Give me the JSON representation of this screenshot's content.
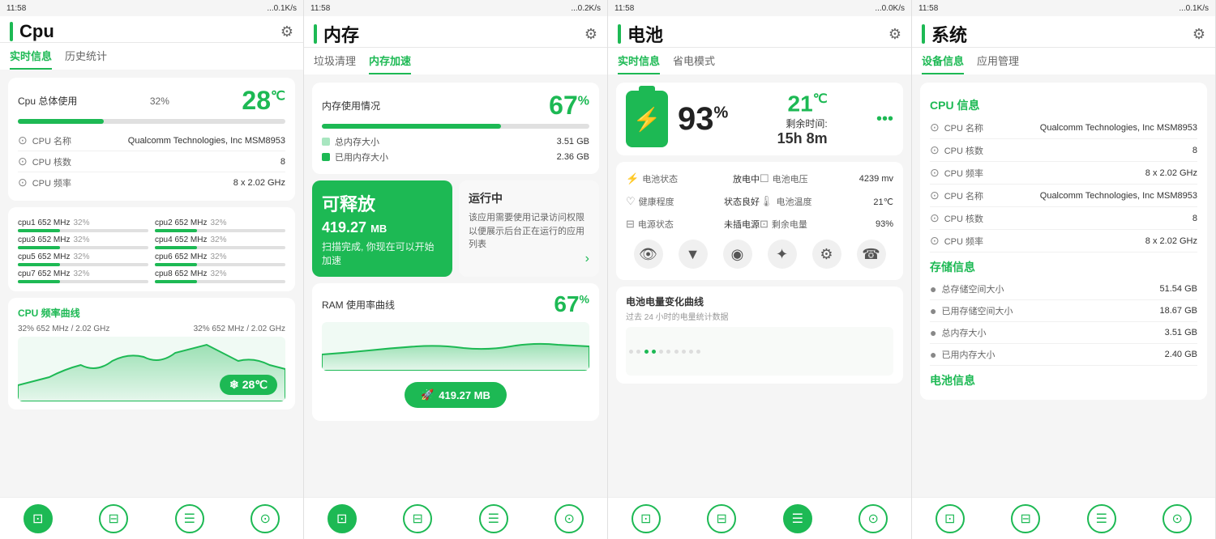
{
  "panels": [
    {
      "id": "cpu",
      "statusBar": {
        "time": "11:58",
        "signal": "...0.1K/s"
      },
      "title": "Cpu",
      "tabs": [
        {
          "label": "实时信息",
          "active": true
        },
        {
          "label": "历史统计",
          "active": false
        }
      ],
      "usageCard": {
        "label": "Cpu 总体使用",
        "pct": "32%",
        "pctNum": 32,
        "temp": "28",
        "tempUnit": "℃"
      },
      "infoRows": [
        {
          "icon": "⊙",
          "label": "CPU 名称",
          "value": "Qualcomm Technologies, Inc MSM8953"
        },
        {
          "icon": "⊙",
          "label": "CPU 核数",
          "value": "8"
        },
        {
          "icon": "⊙",
          "label": "CPU 频率",
          "value": "8 x 2.02 GHz"
        }
      ],
      "cores": [
        {
          "name": "cpu1",
          "freq": "652 MHz",
          "pct": "32%",
          "pctNum": 32
        },
        {
          "name": "cpu2",
          "freq": "652 MHz",
          "pct": "32%",
          "pctNum": 32
        },
        {
          "name": "cpu3",
          "freq": "652 MHz",
          "pct": "32%",
          "pctNum": 32
        },
        {
          "name": "cpu4",
          "freq": "652 MHz",
          "pct": "32%",
          "pctNum": 32
        },
        {
          "name": "cpu5",
          "freq": "652 MHz",
          "pct": "32%",
          "pctNum": 32
        },
        {
          "name": "cpu6",
          "freq": "652 MHz",
          "pct": "32%",
          "pctNum": 32
        },
        {
          "name": "cpu7",
          "freq": "652 MHz",
          "pct": "32%",
          "pctNum": 32
        },
        {
          "name": "cpu8",
          "freq": "652 MHz",
          "pct": "32%",
          "pctNum": 32
        }
      ],
      "chartSection": {
        "title": "CPU 频率曲线",
        "leftLabel": "32%  652 MHz / 2.02 GHz",
        "rightLabel": "32%  652 MHz / 2.02 GHz",
        "temp": "28℃"
      },
      "bottomNav": [
        {
          "icon": "⊡",
          "active": true
        },
        {
          "icon": "⊟",
          "active": false
        },
        {
          "icon": "☰",
          "active": false
        },
        {
          "icon": "⊙",
          "active": false
        }
      ]
    },
    {
      "id": "memory",
      "statusBar": {
        "time": "11:58",
        "signal": "...0.2K/s"
      },
      "title": "内存",
      "tabs": [
        {
          "label": "垃圾清理",
          "active": false
        },
        {
          "label": "内存加速",
          "active": true
        }
      ],
      "memCard": {
        "label": "内存使用情况",
        "pct": "67",
        "pctUnit": "%",
        "pctNum": 67,
        "rows": [
          {
            "type": "light",
            "label": "总内存大小",
            "value": "3.51 GB"
          },
          {
            "type": "dark",
            "label": "已用内存大小",
            "value": "2.36 GB"
          }
        ]
      },
      "releasableCard": {
        "title": "可释放",
        "mb": "419.27",
        "mbUnit": "MB",
        "sub": "扫描完成, 你现在可以开始加速"
      },
      "runningCard": {
        "title": "运行中",
        "desc": "该应用需要使用记录访问权限以便展示后台正在运行的应用列表"
      },
      "ramCurve": {
        "label": "RAM 使用率曲线",
        "pct": "67",
        "pctUnit": "%"
      },
      "floatBtn": {
        "label": "419.27 MB"
      },
      "bottomNav": [
        {
          "icon": "⊡",
          "active": true
        },
        {
          "icon": "⊟",
          "active": false
        },
        {
          "icon": "☰",
          "active": false
        },
        {
          "icon": "⊙",
          "active": false
        }
      ]
    },
    {
      "id": "battery",
      "statusBar": {
        "time": "11:58",
        "signal": "...0.0K/s"
      },
      "title": "电池",
      "tabs": [
        {
          "label": "实时信息",
          "active": true
        },
        {
          "label": "省电模式",
          "active": false
        }
      ],
      "batteryCard": {
        "pct": "93",
        "pctUnit": "%",
        "temp": "21",
        "tempUnit": "℃",
        "remaining": "剩余时间:",
        "remainingValue": "15h 8m"
      },
      "batteryStats": [
        {
          "icon": "⚡",
          "label": "电池状态",
          "value": "放电中"
        },
        {
          "icon": "☐",
          "label": "电池电压",
          "value": "4239 mv"
        },
        {
          "icon": "♡",
          "label": "健康程度",
          "value": "状态良好"
        },
        {
          "icon": "🌡",
          "label": "电池温度",
          "value": "21℃"
        },
        {
          "icon": "⊟",
          "label": "电源状态",
          "value": "未插电源"
        },
        {
          "icon": "⊡",
          "label": "剩余电量",
          "value": "93%"
        }
      ],
      "controlIcons": [
        "👁",
        "▼",
        "◉",
        "✦",
        "⚙",
        "☎"
      ],
      "chartLabel": "电池电量变化曲线",
      "chartSub": "过去 24 小时的电量统计数据",
      "bottomNav": [
        {
          "icon": "⊡",
          "active": false
        },
        {
          "icon": "⊟",
          "active": false
        },
        {
          "icon": "☰",
          "active": true
        },
        {
          "icon": "⊙",
          "active": false
        }
      ]
    },
    {
      "id": "system",
      "statusBar": {
        "time": "11:58",
        "signal": "...0.1K/s"
      },
      "title": "系统",
      "tabs": [
        {
          "label": "设备信息",
          "active": true
        },
        {
          "label": "应用管理",
          "active": false
        }
      ],
      "cpuInfo": {
        "sectionTitle": "CPU 信息",
        "rows": [
          {
            "label": "CPU 名称",
            "value": "Qualcomm Technologies, Inc MSM8953"
          },
          {
            "label": "CPU 核数",
            "value": "8"
          },
          {
            "label": "CPU 频率",
            "value": "8 x 2.02 GHz"
          },
          {
            "label": "CPU 名称",
            "value": "Qualcomm Technologies, Inc MSM8953"
          },
          {
            "label": "CPU 核数",
            "value": "8"
          },
          {
            "label": "CPU 频率",
            "value": "8 x 2.02 GHz"
          }
        ]
      },
      "storageInfo": {
        "sectionTitle": "存储信息",
        "rows": [
          {
            "label": "总存储空间大小",
            "value": "51.54 GB"
          },
          {
            "label": "已用存储空间大小",
            "value": "18.67 GB"
          },
          {
            "label": "总内存大小",
            "value": "3.51 GB"
          },
          {
            "label": "已用内存大小",
            "value": "2.40 GB"
          }
        ]
      },
      "batteryInfo": {
        "sectionTitle": "电池信息"
      },
      "bottomNav": [
        {
          "icon": "⊡",
          "active": false
        },
        {
          "icon": "⊟",
          "active": false
        },
        {
          "icon": "☰",
          "active": false
        },
        {
          "icon": "⊙",
          "active": false
        }
      ]
    }
  ]
}
